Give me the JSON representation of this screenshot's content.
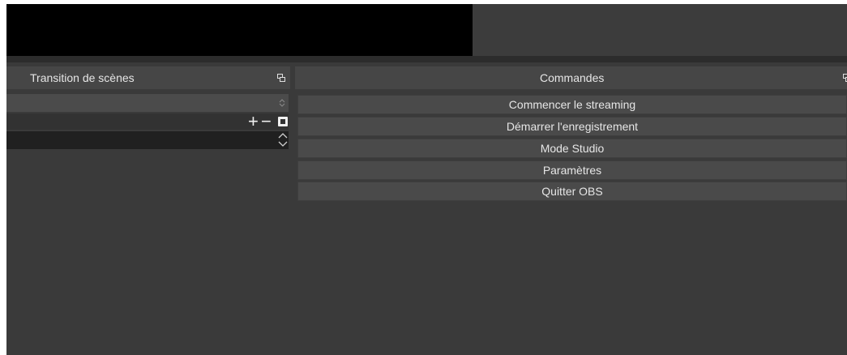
{
  "transitions_dock": {
    "title": "Transition de scènes",
    "add_symbol": "+",
    "remove_symbol": "−"
  },
  "controls_dock": {
    "title": "Commandes",
    "buttons": [
      {
        "label": "Commencer le streaming"
      },
      {
        "label": "Démarrer l'enregistrement"
      },
      {
        "label": "Mode Studio"
      },
      {
        "label": "Paramètres"
      },
      {
        "label": "Quitter OBS"
      }
    ]
  },
  "icons": [
    "float-icon",
    "spinner-icon",
    "properties-icon",
    "chevron-up-icon",
    "chevron-down-icon"
  ],
  "colors": {
    "background": "#3a3a3a",
    "title_bar": "#464646",
    "button": "#4a4a4a",
    "text": "#e6e6e6",
    "preview": "#000000"
  }
}
